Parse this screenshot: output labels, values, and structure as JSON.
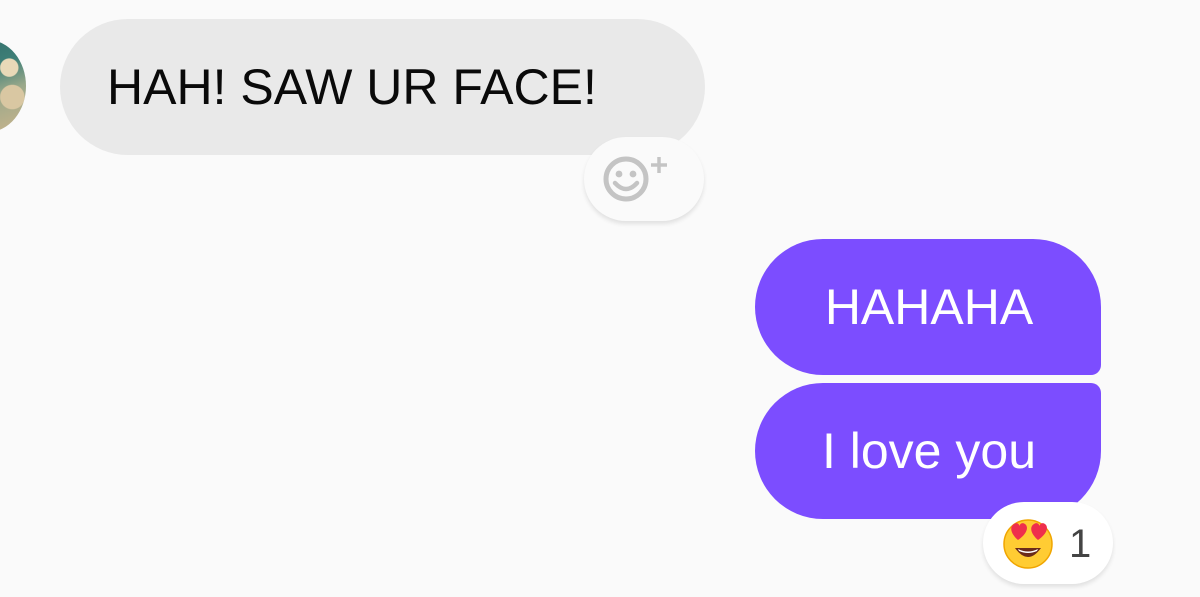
{
  "conversation": {
    "messages": [
      {
        "sender": "other",
        "text": "HAH! SAW UR FACE!",
        "add_reaction_icon": "add-reaction-icon"
      },
      {
        "sender": "me",
        "text": "HAHAHA"
      },
      {
        "sender": "me",
        "text": "I love you",
        "reaction": {
          "icon": "heart-eyes-emoji",
          "count": "1"
        }
      }
    ]
  },
  "colors": {
    "background": "#fafafa",
    "incoming_bubble": "#e9e9e9",
    "outgoing_bubble": "#7c4dff",
    "incoming_text": "#0a0a0a",
    "outgoing_text": "#ffffff"
  }
}
